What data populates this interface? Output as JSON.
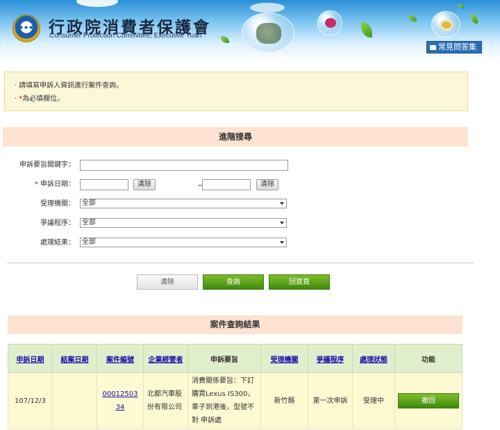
{
  "header": {
    "title": "行政院消費者保護會",
    "subtitle": "Consumer Protection Committee, Executive Yuan",
    "faq_label": "常見問答集"
  },
  "notice": {
    "line1": "請填寫申訴人資訊進行案件查詢。",
    "line2_star": "*",
    "line2": "為必填欄位。"
  },
  "search": {
    "title": "進階搜尋",
    "keyword_label": "申訴要旨關鍵字：",
    "keyword_value": "",
    "date_star": "*",
    "date_label": "申訴日期：",
    "date_from": "",
    "date_to": "",
    "clear_label": "清除",
    "tilde": "~",
    "agency_label": "受理機關：",
    "agency_value": "全部",
    "procedure_label": "爭議程序：",
    "procedure_value": "全部",
    "result_label": "處理結果：",
    "result_value": "全部"
  },
  "actions": {
    "clear": "清除",
    "query": "查詢",
    "home": "回首頁"
  },
  "results": {
    "title": "案件查詢結果",
    "columns": [
      "申訴日期",
      "結案日期",
      "案件編號",
      "企業經營者",
      "申訴要旨",
      "受理機關",
      "爭議程序",
      "處理狀態",
      "功能"
    ],
    "rows": [
      {
        "filed_date": "107/12/3",
        "closed_date": "",
        "case_no_1": "00012503",
        "case_no_2": "34",
        "business": "北都汽車股份有限公司",
        "summary": "消費關係要旨：下訂購買Lexus IS300，車子到港後，型號不對 申訴處",
        "agency": "新竹縣",
        "procedure": "第一次申訴",
        "status": "受理中",
        "action": "撤回"
      }
    ]
  }
}
